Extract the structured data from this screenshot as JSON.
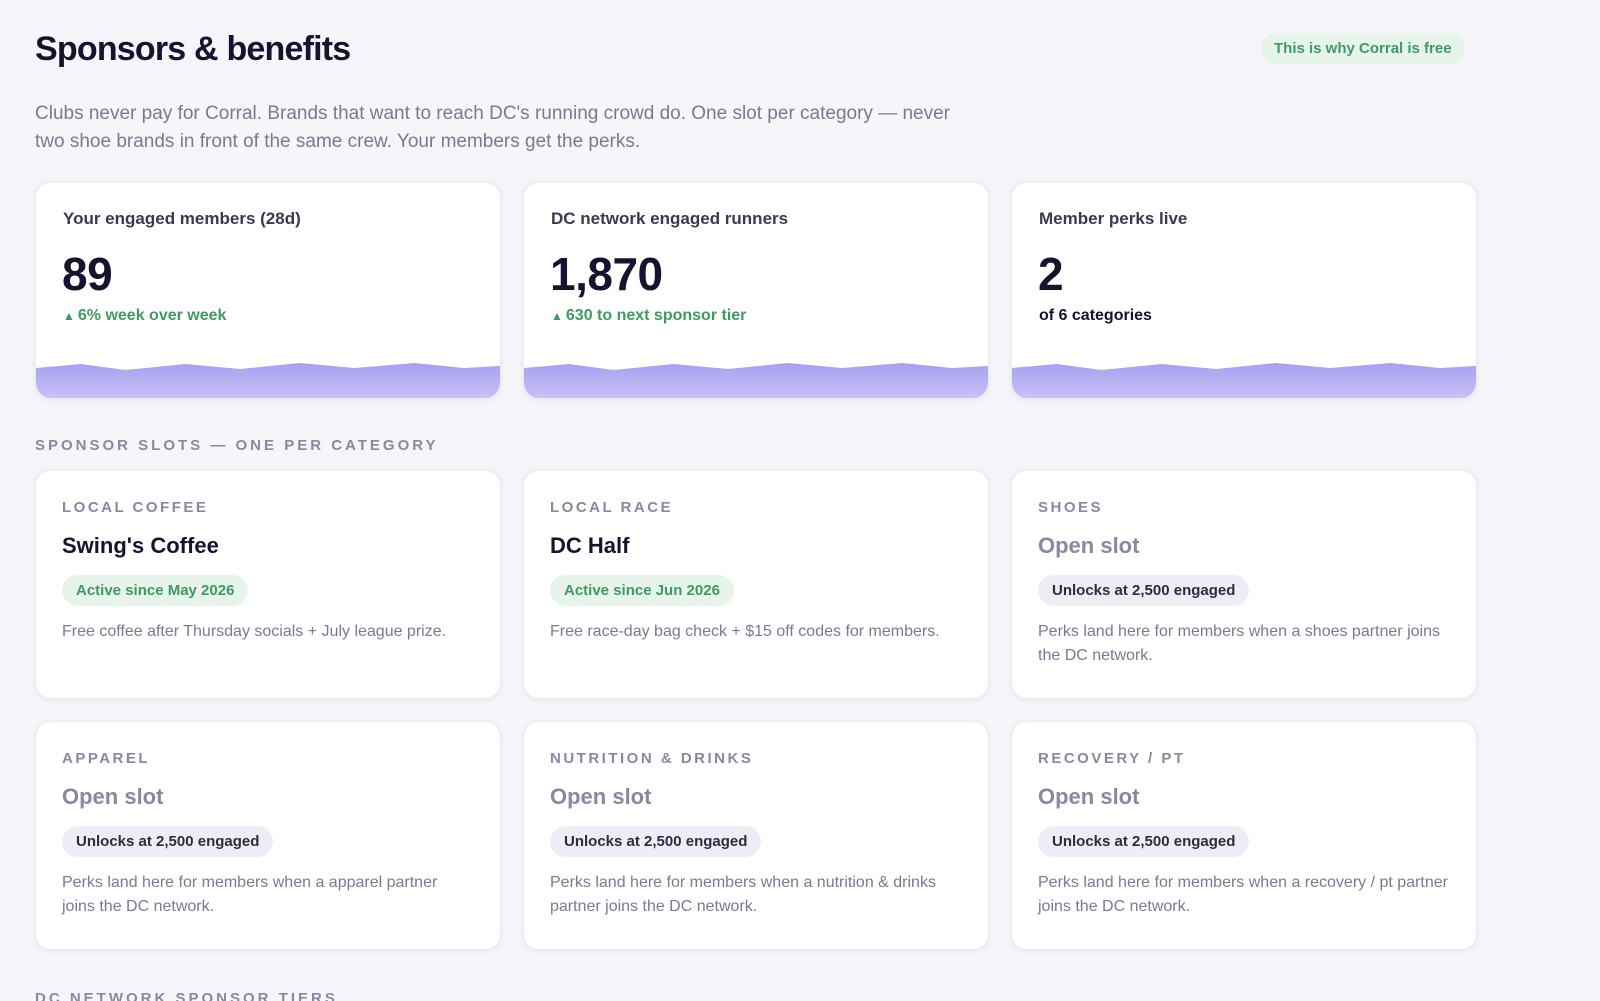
{
  "header": {
    "title": "Sponsors & benefits",
    "badge": "This is why Corral is free",
    "intro": "Clubs never pay for Corral. Brands that want to reach DC's running crowd do. One slot per category — never two shoe brands in front of the same crew. Your members get the perks."
  },
  "stats": [
    {
      "label": "Your engaged members (28d)",
      "value": "89",
      "sub": "6% week over week",
      "sub_icon": "triangle-up-icon",
      "sub_color": "#3f9a62"
    },
    {
      "label": "DC network engaged runners",
      "value": "1,870",
      "sub": "630 to next sponsor tier",
      "sub_icon": "triangle-up-icon",
      "sub_color": "#3f9a62"
    },
    {
      "label": "Member perks live",
      "value": "2",
      "sub": "of 6 categories",
      "sub_icon": "",
      "sub_color": "#15132e"
    }
  ],
  "slots_section": {
    "label": "Sponsor slots — one per category",
    "slots": [
      {
        "category": "Local coffee",
        "name": "Swing's Coffee",
        "status": "active",
        "badge": "Active since May 2026",
        "description": "Free coffee after Thursday socials + July league prize."
      },
      {
        "category": "Local race",
        "name": "DC Half",
        "status": "active",
        "badge": "Active since Jun 2026",
        "description": "Free race-day bag check + $15 off codes for members."
      },
      {
        "category": "Shoes",
        "name": "Open slot",
        "status": "open",
        "badge": "Unlocks at 2,500 engaged",
        "description": "Perks land here for members when a shoes partner joins the DC network."
      },
      {
        "category": "Apparel",
        "name": "Open slot",
        "status": "open",
        "badge": "Unlocks at 2,500 engaged",
        "description": "Perks land here for members when a apparel partner joins the DC network."
      },
      {
        "category": "Nutrition & drinks",
        "name": "Open slot",
        "status": "open",
        "badge": "Unlocks at 2,500 engaged",
        "description": "Perks land here for members when a nutrition & drinks partner joins the DC network."
      },
      {
        "category": "Recovery / PT",
        "name": "Open slot",
        "status": "open",
        "badge": "Unlocks at 2,500 engaged",
        "description": "Perks land here for members when a recovery / pt partner joins the DC network."
      }
    ]
  },
  "tiers_section": {
    "label": "DC network sponsor tiers"
  },
  "colors": {
    "accent_green": "#3f9a62",
    "green_bg": "#e6f4ea",
    "wave_purple": "#a79ff0",
    "page_bg": "#f5f5fa"
  }
}
